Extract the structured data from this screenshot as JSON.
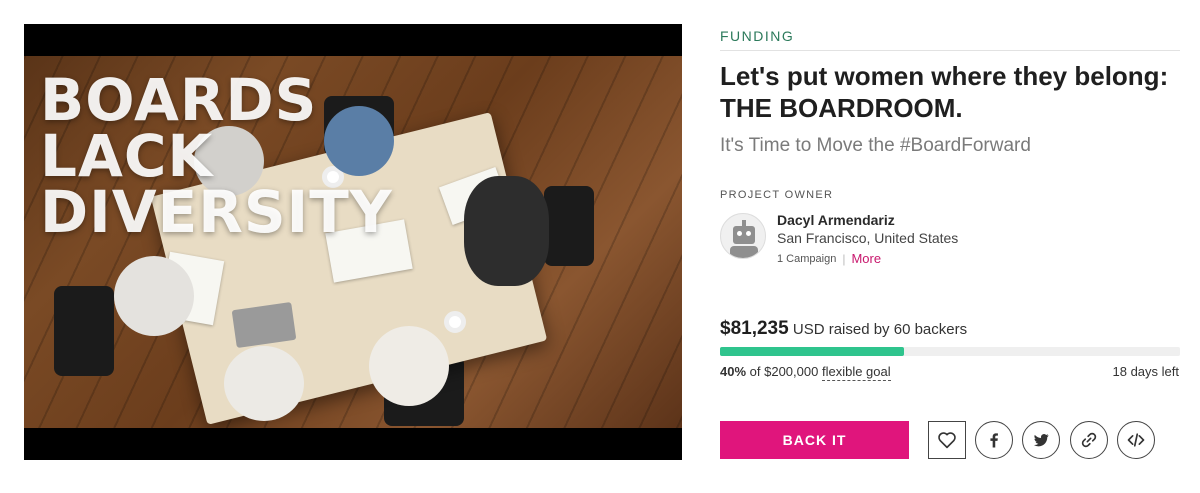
{
  "video": {
    "headline_lines": [
      "BOARDS",
      "LACK",
      "DIVERSITY"
    ]
  },
  "campaign": {
    "category": "FUNDING",
    "title": "Let's put women where they belong: THE BOARDROOM.",
    "tagline": "It's Time to Move the #BoardForward"
  },
  "owner": {
    "label": "PROJECT OWNER",
    "name": "Dacyl Armendariz",
    "location": "San Francisco, United States",
    "campaigns": "1 Campaign",
    "separator": "|",
    "more_link": "More",
    "avatar_icon": "robot-avatar-icon"
  },
  "funding": {
    "amount": "$81,235",
    "raised_text": "USD raised by 60 backers",
    "progress_fraction": 0.4,
    "percent": "40%",
    "goal_text": "of $200,000",
    "goal_type": "flexible goal",
    "days_left": "18 days left"
  },
  "actions": {
    "back_label": "BACK IT",
    "follow_icon": "heart-icon",
    "share_icons": [
      "facebook-icon",
      "twitter-icon",
      "link-icon",
      "embed-icon"
    ]
  },
  "colors": {
    "category": "#2c7a5b",
    "accent": "#e0157c",
    "progress": "#2fc48d",
    "more_link": "#c8176d"
  }
}
